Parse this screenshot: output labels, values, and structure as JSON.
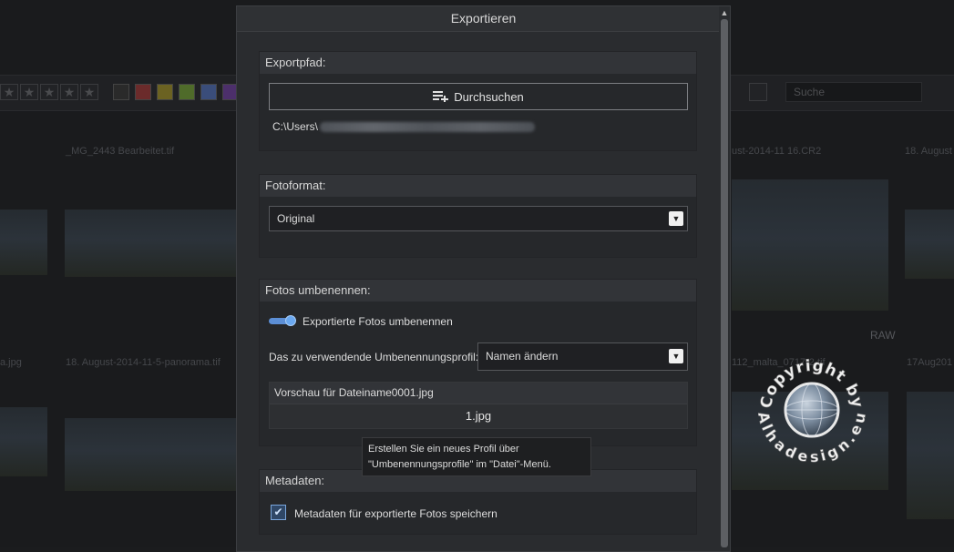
{
  "dialog": {
    "title": "Exportieren"
  },
  "export_path": {
    "heading": "Exportpfad:",
    "browse_label": "Durchsuchen",
    "path_prefix": "C:\\Users\\"
  },
  "photo_format": {
    "heading": "Fotoformat:",
    "selected": "Original"
  },
  "rename": {
    "heading": "Fotos umbenennen:",
    "toggle_label": "Exportierte Fotos umbenennen",
    "toggle_on": true,
    "profile_label": "Das zu verwendende Umbenennungsprofil:",
    "profile_selected": "Namen ändern",
    "preview_label": "Vorschau für Dateiname0001.jpg",
    "preview_value": "1.jpg"
  },
  "tooltip": {
    "line1": "Erstellen Sie ein neues Profil über",
    "line2": "\"Umbenennungsprofile\" im \"Datei\"-Menü."
  },
  "metadata": {
    "heading": "Metadaten:",
    "checkbox_label": "Metadaten für exportierte Fotos speichern",
    "checked": true
  },
  "background": {
    "search_placeholder": "Suche",
    "captions": [
      "_MG_2443 Bearbeitet.tif",
      "ust-2014-11 16.CR2",
      "18. August",
      "a.jpg",
      "18. August-2014-11-5-panorama.tif",
      "112_malta_0717-2.tif",
      "17Aug201"
    ],
    "raw_badge": "RAW"
  },
  "watermark": {
    "text_top": "Copyright by",
    "text_bottom": "Alhadesign.eu"
  },
  "colors": {
    "accent": "#5c8fd6",
    "dialog_bg": "#2a2c2f",
    "section_header": "#323438"
  }
}
